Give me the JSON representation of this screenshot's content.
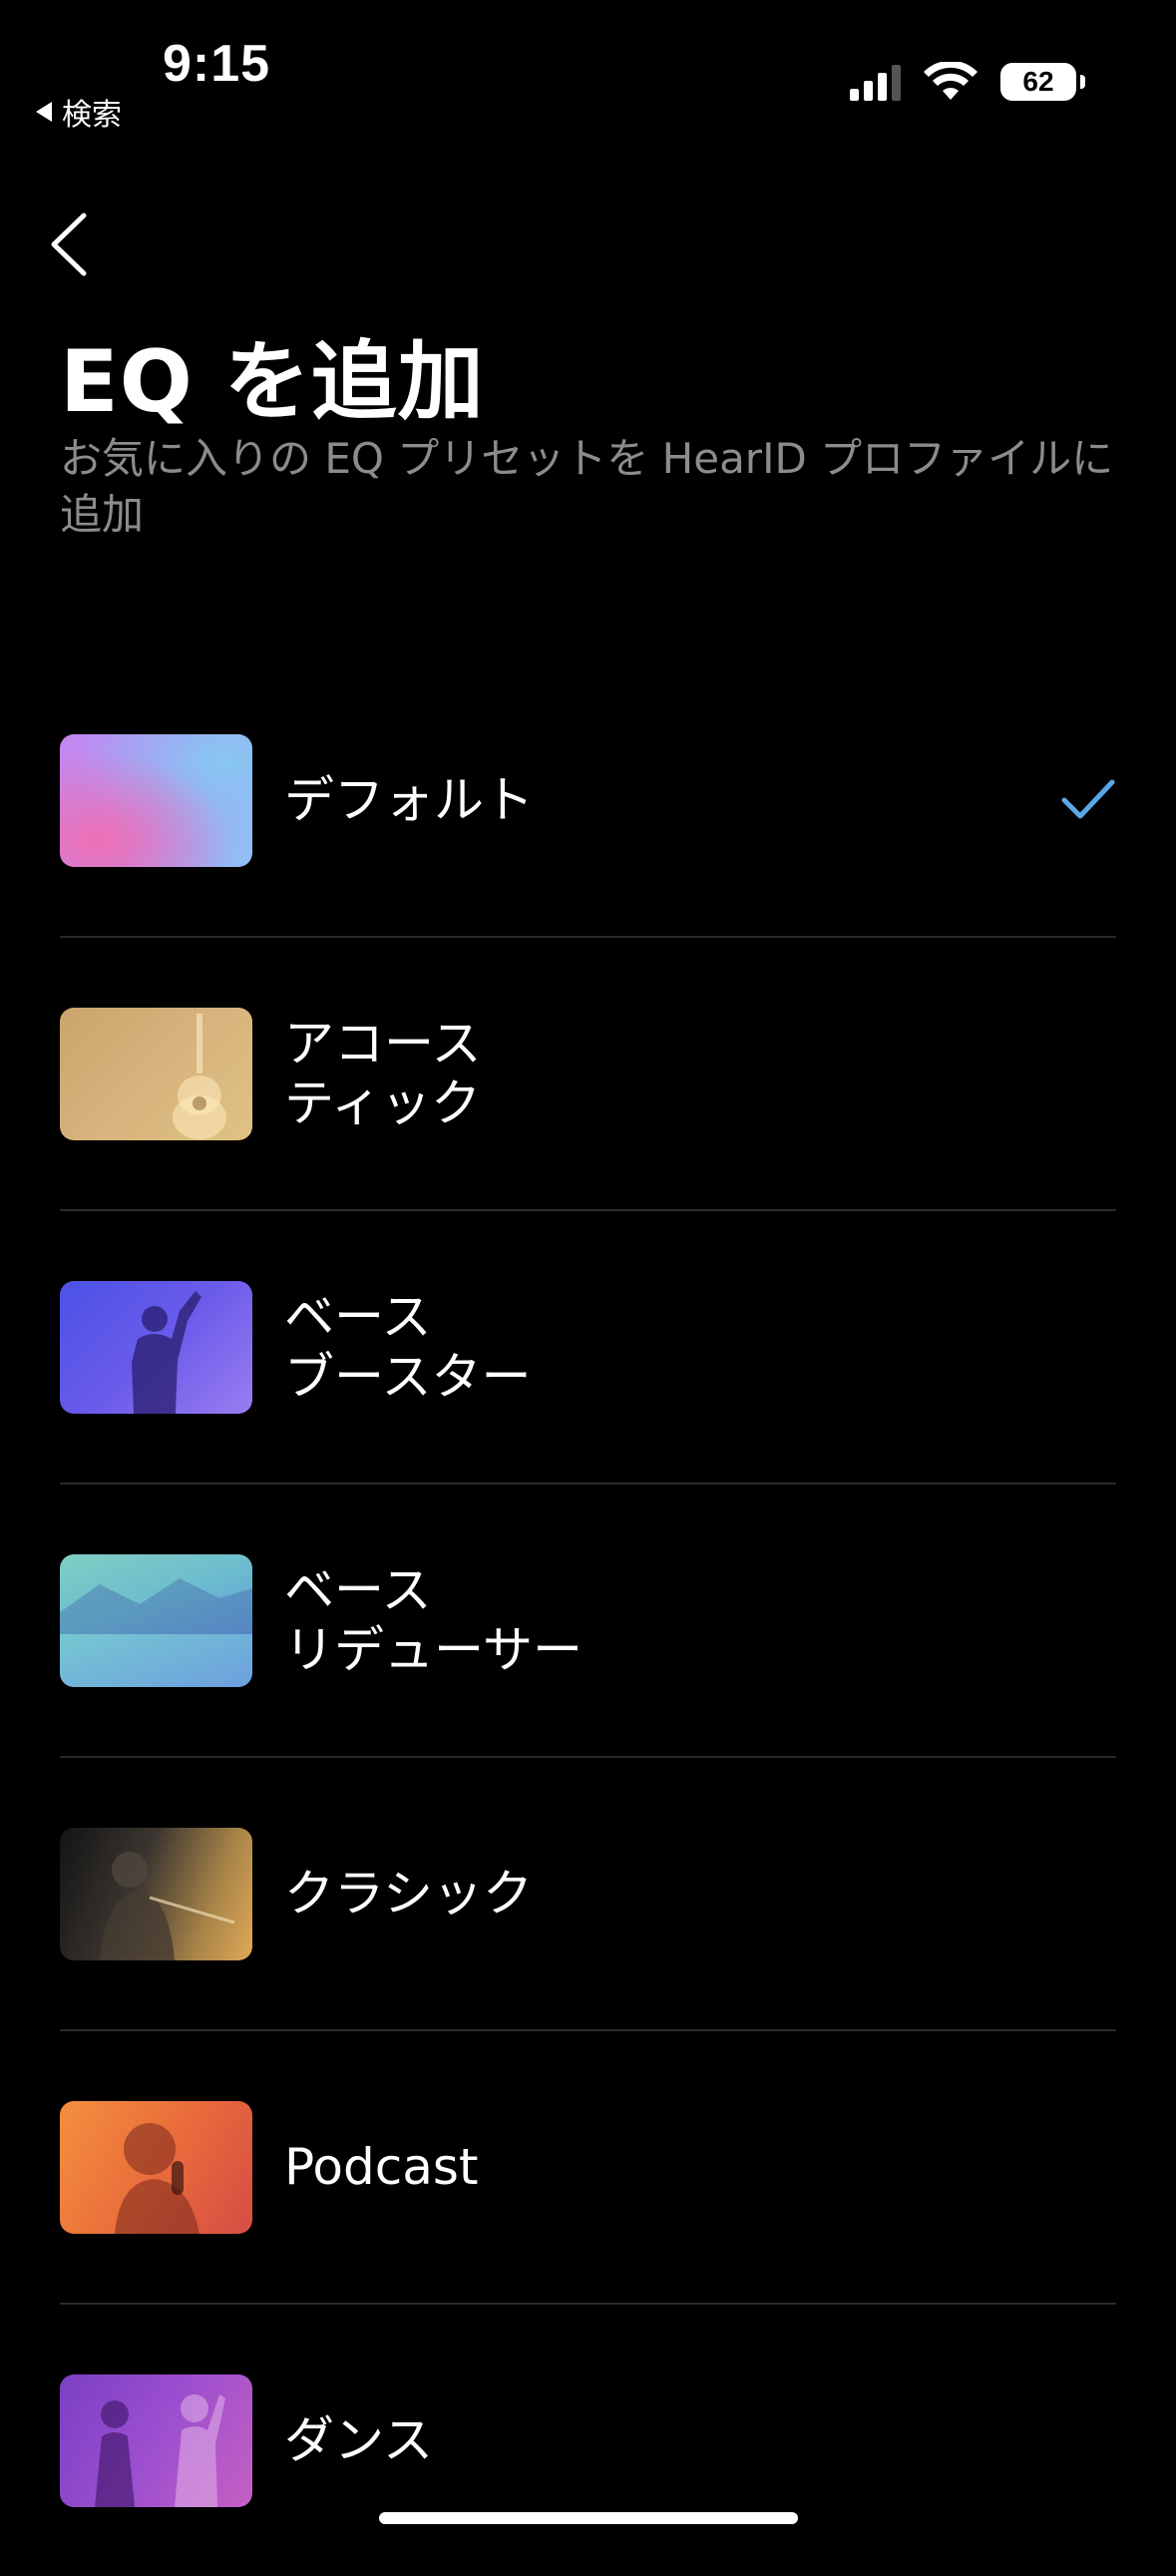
{
  "status_bar": {
    "time": "9:15",
    "back_app_label": "検索",
    "battery_level": "62"
  },
  "header": {
    "title": "EQ を追加",
    "subtitle": "お気に入りの EQ プリセットを HearID プロファイルに追加"
  },
  "presets": [
    {
      "label": "デフォルト",
      "selected": true,
      "thumbnail": "pink-blue-gradient"
    },
    {
      "label": "アコース\nティック",
      "selected": false,
      "thumbnail": "guitar"
    },
    {
      "label": "ベース\nブースター",
      "selected": false,
      "thumbnail": "performer"
    },
    {
      "label": "ベース\nリデューサー",
      "selected": false,
      "thumbnail": "lake-mountains"
    },
    {
      "label": "クラシック",
      "selected": false,
      "thumbnail": "violinist"
    },
    {
      "label": "Podcast",
      "selected": false,
      "thumbnail": "singer-microphone"
    },
    {
      "label": "ダンス",
      "selected": false,
      "thumbnail": "dancers"
    }
  ],
  "colors": {
    "background": "#000000",
    "accent_check": "#5aa7e6",
    "subtitle": "#8c8c8c",
    "divider": "#2a2a2a"
  }
}
